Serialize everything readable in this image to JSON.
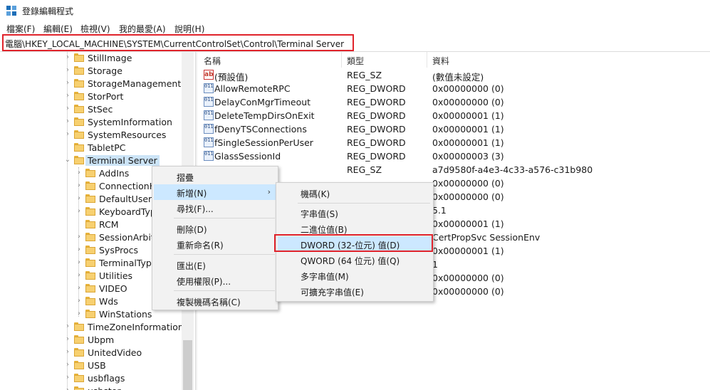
{
  "window": {
    "title": "登錄編輯程式"
  },
  "menubar": [
    {
      "label": "檔案(F)"
    },
    {
      "label": "編輯(E)"
    },
    {
      "label": "檢視(V)"
    },
    {
      "label": "我的最愛(A)"
    },
    {
      "label": "說明(H)"
    }
  ],
  "address": {
    "path": "電腦\\HKEY_LOCAL_MACHINE\\SYSTEM\\CurrentControlSet\\Control\\Terminal Server"
  },
  "tree": {
    "items": [
      {
        "label": "StillImage"
      },
      {
        "label": "Storage"
      },
      {
        "label": "StorageManagement"
      },
      {
        "label": "StorPort"
      },
      {
        "label": "StSec"
      },
      {
        "label": "SystemInformation"
      },
      {
        "label": "SystemResources"
      },
      {
        "label": "TabletPC"
      },
      {
        "label": "Terminal Server"
      },
      {
        "label": "AddIns"
      },
      {
        "label": "ConnectionH"
      },
      {
        "label": "DefaultUserC"
      },
      {
        "label": "KeyboardTyp"
      },
      {
        "label": "RCM"
      },
      {
        "label": "SessionArbitr"
      },
      {
        "label": "SysProcs"
      },
      {
        "label": "TerminalType"
      },
      {
        "label": "Utilities"
      },
      {
        "label": "VIDEO"
      },
      {
        "label": "Wds"
      },
      {
        "label": "WinStations"
      },
      {
        "label": "TimeZoneInformation"
      },
      {
        "label": "Ubpm"
      },
      {
        "label": "UnitedVideo"
      },
      {
        "label": "USB"
      },
      {
        "label": "usbflags"
      },
      {
        "label": "usbstor"
      }
    ]
  },
  "list": {
    "columns": [
      "名稱",
      "類型",
      "資料"
    ],
    "rows": [
      {
        "name": "(預設值)",
        "type": "REG_SZ",
        "data": "(數值未設定)"
      },
      {
        "name": "AllowRemoteRPC",
        "type": "REG_DWORD",
        "data": "0x00000000 (0)"
      },
      {
        "name": "DelayConMgrTimeout",
        "type": "REG_DWORD",
        "data": "0x00000000 (0)"
      },
      {
        "name": "DeleteTempDirsOnExit",
        "type": "REG_DWORD",
        "data": "0x00000001 (1)"
      },
      {
        "name": "fDenyTSConnections",
        "type": "REG_DWORD",
        "data": "0x00000001 (1)"
      },
      {
        "name": "fSingleSessionPerUser",
        "type": "REG_DWORD",
        "data": "0x00000001 (1)"
      },
      {
        "name": "GlassSessionId",
        "type": "REG_DWORD",
        "data": "0x00000003 (3)"
      },
      {
        "name": "",
        "type": "REG_SZ",
        "data": "a7d9580f-a4e3-4c33-a576-c31b980"
      },
      {
        "name": "",
        "type": "",
        "data": "0x00000000 (0)"
      },
      {
        "name": "",
        "type": "",
        "data": "0x00000000 (0)"
      },
      {
        "name": "",
        "type": "",
        "data": "5.1"
      },
      {
        "name": "",
        "type": "",
        "data": "0x00000001 (1)"
      },
      {
        "name": "",
        "type": "",
        "data": "CertPropSvc SessionEnv"
      },
      {
        "name": "",
        "type": "",
        "data": "0x00000001 (1)"
      },
      {
        "name": "",
        "type": "",
        "data": "1"
      },
      {
        "name": "",
        "type": "",
        "data": "0x00000000 (0)"
      },
      {
        "name": "",
        "type": "",
        "data": "0x00000000 (0)"
      }
    ]
  },
  "context_menu": {
    "items": [
      {
        "label": "摺疊"
      },
      {
        "label": "新增(N)"
      },
      {
        "label": "尋找(F)..."
      },
      {
        "label": "刪除(D)"
      },
      {
        "label": "重新命名(R)"
      },
      {
        "label": "匯出(E)"
      },
      {
        "label": "使用權限(P)..."
      },
      {
        "label": "複製機碼名稱(C)"
      }
    ],
    "submenu_arrow": "›"
  },
  "submenu": {
    "items": [
      {
        "label": "機碼(K)"
      },
      {
        "label": "字串值(S)"
      },
      {
        "label": "二進位值(B)"
      },
      {
        "label": "DWORD (32-位元) 值(D)"
      },
      {
        "label": "QWORD (64 位元) 值(Q)"
      },
      {
        "label": "多字串值(M)"
      },
      {
        "label": "可擴充字串值(E)"
      }
    ]
  },
  "colors": {
    "highlight_box": "#e0232b",
    "menu_hover": "#cce8ff",
    "folder": "#f7d070"
  }
}
